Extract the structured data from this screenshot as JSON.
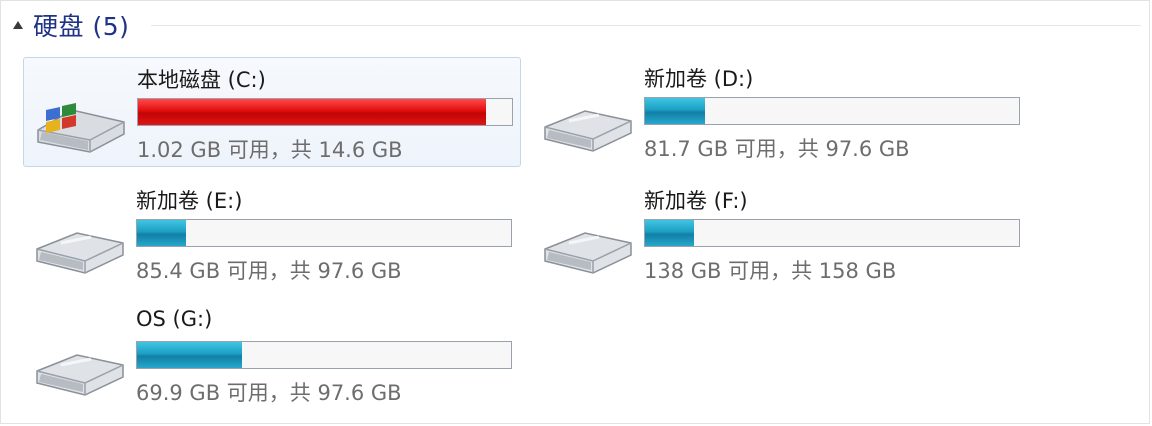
{
  "group": {
    "title": "硬盘 (5)"
  },
  "drives": [
    {
      "name": "本地磁盘 (C:)",
      "space": "1.02 GB 可用，共 14.6 GB",
      "used_fraction": 0.93,
      "bar_color": "red",
      "selected": true,
      "icon": "windows-system-drive-icon"
    },
    {
      "name": "新加卷 (D:)",
      "space": "81.7 GB 可用，共 97.6 GB",
      "used_fraction": 0.16,
      "bar_color": "blue",
      "selected": false,
      "icon": "hard-drive-icon"
    },
    {
      "name": "新加卷 (E:)",
      "space": "85.4 GB 可用，共 97.6 GB",
      "used_fraction": 0.13,
      "bar_color": "blue",
      "selected": false,
      "icon": "hard-drive-icon"
    },
    {
      "name": "新加卷 (F:)",
      "space": "138 GB 可用，共 158 GB",
      "used_fraction": 0.13,
      "bar_color": "blue",
      "selected": false,
      "icon": "hard-drive-icon"
    },
    {
      "name": "OS (G:)",
      "space": "69.9 GB 可用，共 97.6 GB",
      "used_fraction": 0.28,
      "bar_color": "blue",
      "selected": false,
      "icon": "hard-drive-icon"
    }
  ],
  "colors": {
    "group_title": "#1e3287",
    "bar_blue": "#1c9fc4",
    "bar_red": "#e20e0e",
    "selection_border": "#c4d6ec"
  }
}
